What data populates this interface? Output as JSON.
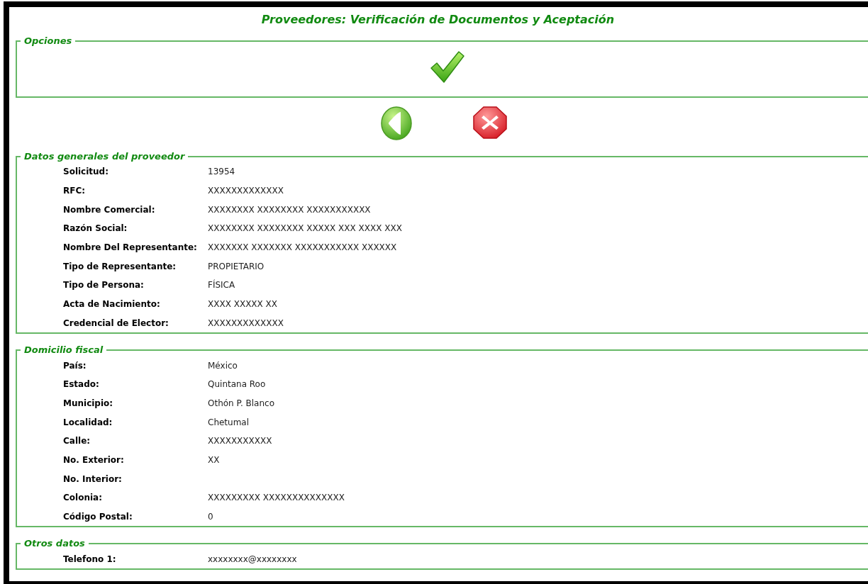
{
  "title": "Proveedores: Verificación de Documentos y Aceptación",
  "options": {
    "legend": "Opciones"
  },
  "sections": [
    {
      "legend": "Datos generales del proveedor",
      "rows": [
        {
          "label": "Solicitud:",
          "value": "13954"
        },
        {
          "label": "RFC:",
          "value": "XXXXXXXXXXXXX"
        },
        {
          "label": "Nombre Comercial:",
          "value": "XXXXXXXX XXXXXXXX XXXXXXXXXXX"
        },
        {
          "label": "Razón Social:",
          "value": "XXXXXXXX XXXXXXXX XXXXX XXX XXXX XXX"
        },
        {
          "label": "Nombre Del Representante:",
          "value": "XXXXXXX XXXXXXX XXXXXXXXXXX XXXXXX"
        },
        {
          "label": "Tipo de Representante:",
          "value": "PROPIETARIO"
        },
        {
          "label": "Tipo de Persona:",
          "value": "FÍSICA"
        },
        {
          "label": "Acta de Nacimiento:",
          "value": "XXXX XXXXX XX"
        },
        {
          "label": "Credencial de Elector:",
          "value": "XXXXXXXXXXXXX"
        }
      ]
    },
    {
      "legend": "Domicilio fiscal",
      "rows": [
        {
          "label": "País:",
          "value": "México"
        },
        {
          "label": "Estado:",
          "value": "Quintana Roo"
        },
        {
          "label": "Municipio:",
          "value": "Othón P. Blanco"
        },
        {
          "label": "Localidad:",
          "value": "Chetumal"
        },
        {
          "label": "Calle:",
          "value": "XXXXXXXXXXX"
        },
        {
          "label": "No. Exterior:",
          "value": "XX"
        },
        {
          "label": "No. Interior:"
        },
        {
          "label": "Colonia:",
          "value": "XXXXXXXXX XXXXXXXXXXXXXX"
        },
        {
          "label": "Código Postal:",
          "value": "0"
        }
      ]
    },
    {
      "legend": "Otros datos",
      "rows": [
        {
          "label": "Telefono 1:",
          "value": "xxxxxxxx@xxxxxxxx"
        }
      ]
    }
  ]
}
